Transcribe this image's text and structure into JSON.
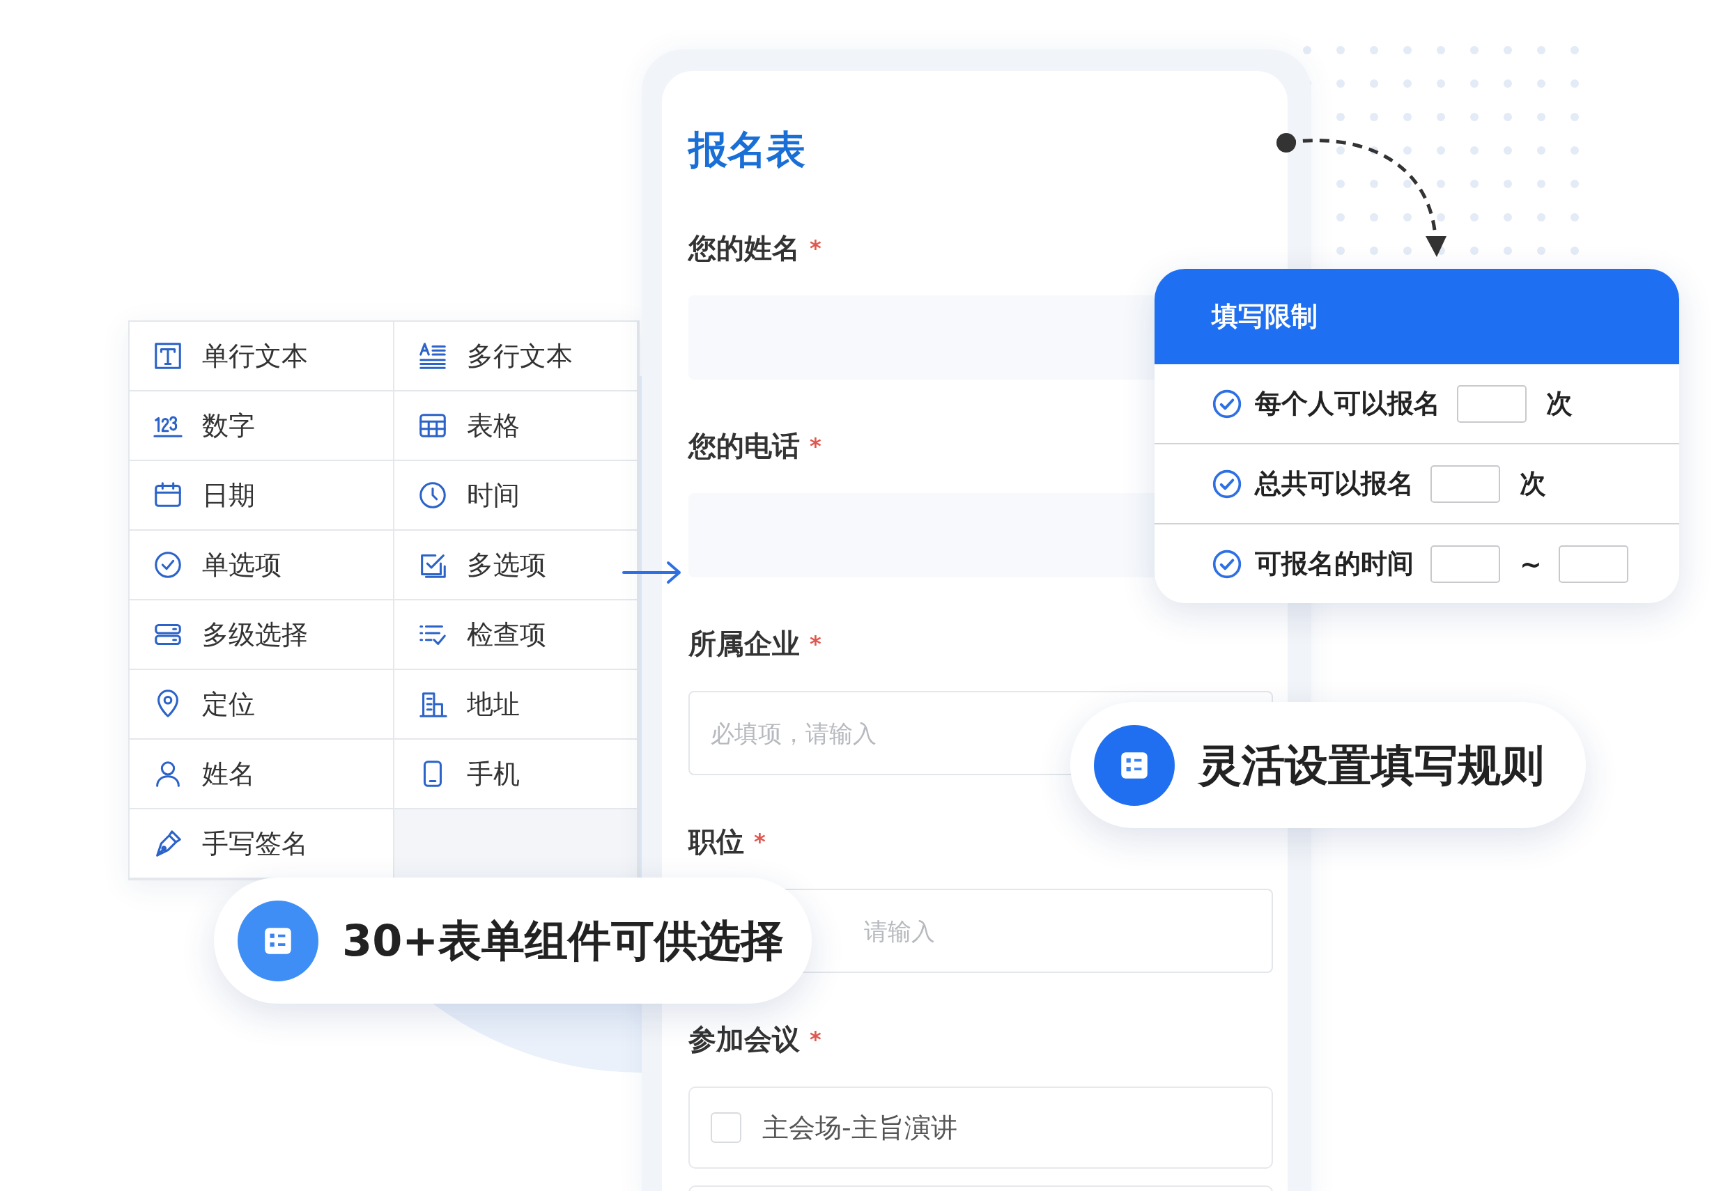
{
  "components": {
    "items": [
      {
        "label": "单行文本"
      },
      {
        "label": "多行文本"
      },
      {
        "label": "数字"
      },
      {
        "label": "表格"
      },
      {
        "label": "日期"
      },
      {
        "label": "时间"
      },
      {
        "label": "单选项"
      },
      {
        "label": "多选项"
      },
      {
        "label": "多级选择"
      },
      {
        "label": "检查项"
      },
      {
        "label": "定位"
      },
      {
        "label": "地址"
      },
      {
        "label": "姓名"
      },
      {
        "label": "手机"
      },
      {
        "label": "手写签名"
      }
    ]
  },
  "form": {
    "title": "报名表",
    "fields": [
      {
        "label": "您的姓名",
        "mark": "*",
        "kind": "shaded"
      },
      {
        "label": "您的电话",
        "mark": "*",
        "kind": "shaded"
      },
      {
        "label": "所属企业",
        "mark": "*",
        "kind": "outlined",
        "placeholder": "必填项，请输入"
      },
      {
        "label": "职位",
        "mark": "*",
        "kind": "outlined",
        "placeholder": "请输入"
      },
      {
        "label": "参加会议",
        "mark": "*",
        "kind": "options",
        "options": [
          {
            "label": "主会场-主旨演讲",
            "checked": false
          }
        ]
      }
    ]
  },
  "restrictions": {
    "title": "填写限制",
    "rows": [
      {
        "kind": "count",
        "label": "每个人可以报名",
        "unit": "次",
        "checked": true
      },
      {
        "kind": "count",
        "label": "总共可以报名",
        "unit": "次",
        "checked": true
      },
      {
        "kind": "range",
        "label": "可报名的时间",
        "separator": "~",
        "checked": true
      }
    ]
  },
  "badges": [
    {
      "text": "30+表单组件可供选择"
    },
    {
      "text": "灵活设置填写规则"
    }
  ]
}
